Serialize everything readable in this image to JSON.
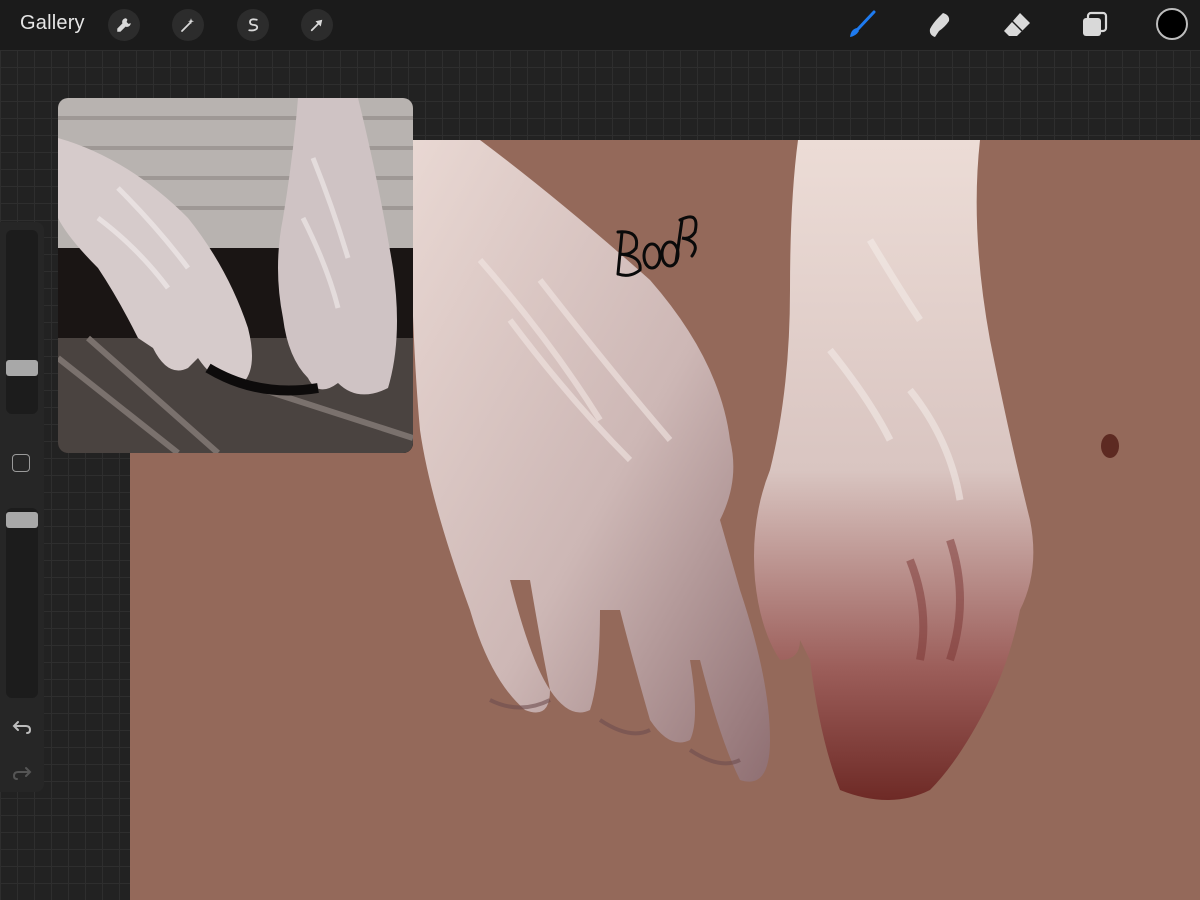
{
  "toolbar": {
    "gallery_label": "Gallery",
    "left_tools": [
      "wrench-icon",
      "magic-wand-icon",
      "selection-icon",
      "transform-arrow-icon"
    ],
    "right_tools": [
      "brush-icon",
      "smudge-icon",
      "eraser-icon",
      "layers-icon"
    ],
    "active_tool": "brush-icon",
    "accent_color": "#1e7bf0",
    "current_color": "#000000"
  },
  "canvas": {
    "background_color": "#94695a",
    "signature_text": "BOB"
  },
  "reference": {
    "description_icon": "reference-photo"
  },
  "sidebar": {
    "brush_size_level": 0.27,
    "opacity_level": 1.0,
    "undo_icon": "undo-icon",
    "redo_icon": "redo-icon"
  }
}
